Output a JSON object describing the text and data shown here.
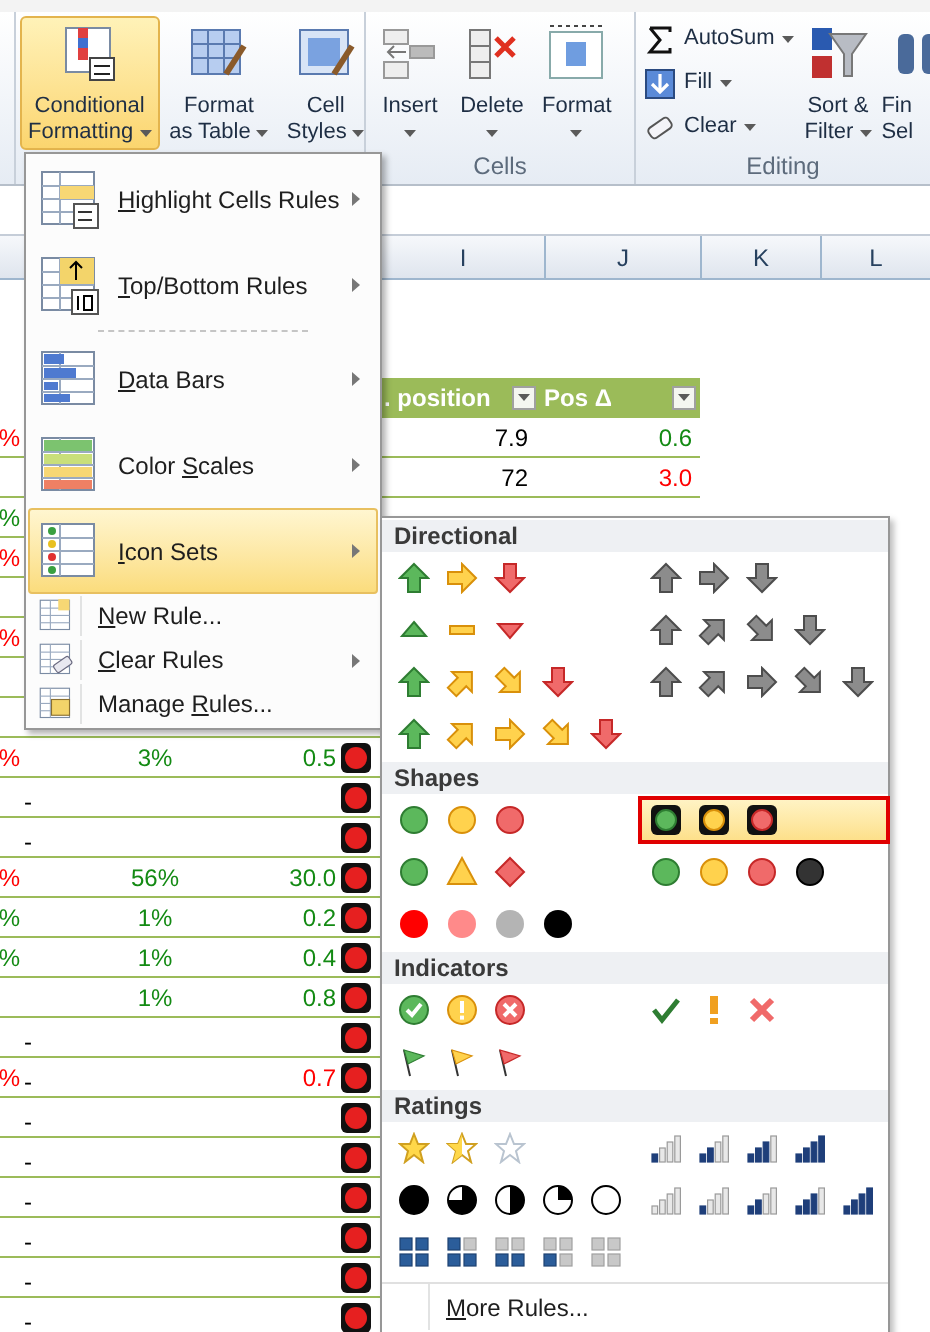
{
  "ribbon": {
    "groups": [
      {
        "buttons": [
          {
            "kind": "large",
            "lines": [
              "Conditional",
              "Formatting"
            ],
            "dropdown": true,
            "expanded": true
          },
          {
            "kind": "large",
            "lines": [
              "Format",
              "as Table"
            ],
            "dropdown": true,
            "expanded": false
          },
          {
            "kind": "large",
            "lines": [
              "Cell",
              "Styles"
            ],
            "dropdown": true,
            "expanded": false
          }
        ]
      },
      {
        "label": "Cells",
        "buttons": [
          {
            "kind": "large",
            "lines": [
              "Insert"
            ],
            "dropdown": true,
            "expanded": false
          },
          {
            "kind": "large",
            "lines": [
              "Delete"
            ],
            "dropdown": true,
            "expanded": false
          },
          {
            "kind": "large",
            "lines": [
              "Format"
            ],
            "dropdown": true,
            "expanded": false
          }
        ]
      },
      {
        "label": "Editing",
        "buttons": [
          {
            "kind": "small",
            "lines": [
              "AutoSum"
            ],
            "dropdown": true,
            "expanded": false
          },
          {
            "kind": "small",
            "lines": [
              "Fill"
            ],
            "dropdown": true,
            "expanded": false
          },
          {
            "kind": "small",
            "lines": [
              "Clear"
            ],
            "dropdown": true,
            "expanded": false
          },
          {
            "kind": "large",
            "lines": [
              "Sort &",
              "Filter"
            ],
            "dropdown": true,
            "expanded": false
          },
          {
            "kind": "large",
            "lines": [
              "Fin",
              "Sel"
            ],
            "dropdown": false,
            "expanded": false
          }
        ]
      }
    ]
  },
  "sheet": {
    "columns": [
      "I",
      "J",
      "K",
      "L"
    ],
    "table_header": [
      ". position",
      "Pos Δ"
    ],
    "rows": [
      {
        "edge": {
          "text": "%",
          "color": "#ff0000"
        },
        "i": {
          "text": "7.9",
          "color": "#000000"
        },
        "j": {
          "text": "0.6",
          "color": "#138a13"
        }
      },
      {
        "i": {
          "text": "72",
          "color": "#000000"
        },
        "j": {
          "text": "3.0",
          "color": "#ff0000"
        }
      },
      {
        "edge": {
          "text": "%",
          "color": "#138a13"
        }
      },
      {
        "edge": {
          "text": "%",
          "color": "#ff0000"
        }
      },
      {},
      {
        "edge": {
          "text": "%",
          "color": "#ff0000"
        }
      },
      {},
      {},
      {
        "edge": {
          "text": "%",
          "color": "#ff0000"
        },
        "c": {
          "text": "3%",
          "color": "#138a13"
        },
        "d": {
          "text": "0.5",
          "color": "#138a13"
        },
        "indicator": {
          "color": "#e62020"
        }
      },
      {
        "b": {
          "text": "-",
          "color": "#000000"
        },
        "indicator": {
          "color": "#e62020"
        }
      },
      {
        "b": {
          "text": "-",
          "color": "#000000"
        },
        "indicator": {
          "color": "#e62020"
        }
      },
      {
        "edge": {
          "text": "%",
          "color": "#ff0000"
        },
        "c": {
          "text": "56%",
          "color": "#138a13"
        },
        "d": {
          "text": "30.0",
          "color": "#138a13"
        },
        "indicator": {
          "color": "#e62020"
        }
      },
      {
        "edge": {
          "text": "%",
          "color": "#138a13"
        },
        "c": {
          "text": "1%",
          "color": "#138a13"
        },
        "d": {
          "text": "0.2",
          "color": "#138a13"
        },
        "indicator": {
          "color": "#e62020"
        }
      },
      {
        "edge": {
          "text": "%",
          "color": "#138a13"
        },
        "c": {
          "text": "1%",
          "color": "#138a13"
        },
        "d": {
          "text": "0.4",
          "color": "#138a13"
        },
        "indicator": {
          "color": "#e62020"
        }
      },
      {
        "c": {
          "text": "1%",
          "color": "#138a13"
        },
        "d": {
          "text": "0.8",
          "color": "#138a13"
        },
        "indicator": {
          "color": "#e62020"
        }
      },
      {
        "b": {
          "text": "-",
          "color": "#000000"
        },
        "indicator": {
          "color": "#e62020"
        }
      },
      {
        "edge": {
          "text": "%",
          "color": "#ff0000"
        },
        "b": {
          "text": "-",
          "color": "#000000"
        },
        "d": {
          "text": "0.7",
          "color": "#ff0000"
        },
        "indicator": {
          "color": "#e62020"
        }
      },
      {
        "b": {
          "text": "-",
          "color": "#000000"
        },
        "indicator": {
          "color": "#e62020"
        }
      },
      {
        "b": {
          "text": "-",
          "color": "#000000"
        },
        "indicator": {
          "color": "#e62020"
        }
      },
      {
        "b": {
          "text": "-",
          "color": "#000000"
        },
        "indicator": {
          "color": "#e62020"
        }
      },
      {
        "b": {
          "text": "-",
          "color": "#000000"
        },
        "indicator": {
          "color": "#e62020"
        }
      },
      {
        "b": {
          "text": "-",
          "color": "#000000"
        },
        "indicator": {
          "color": "#e62020"
        }
      },
      {
        "b": {
          "text": "-",
          "color": "#000000"
        },
        "indicator": {
          "color": "#e62020"
        }
      }
    ]
  },
  "menu": {
    "items": [
      {
        "kind": "large",
        "key": "H",
        "post": "ighlight Cells Rules",
        "submenu": true,
        "selected": false
      },
      {
        "kind": "large",
        "key": "T",
        "post": "op/Bottom Rules",
        "submenu": true,
        "selected": false
      },
      {
        "kind": "large",
        "key": "D",
        "post": "ata Bars",
        "submenu": true,
        "selected": false
      },
      {
        "kind": "large",
        "pre": "Color ",
        "key": "S",
        "post": "cales",
        "submenu": true,
        "selected": false
      },
      {
        "kind": "large",
        "key": "I",
        "post": "con Sets",
        "submenu": true,
        "selected": true
      },
      {
        "kind": "small",
        "key": "N",
        "post": "ew Rule...",
        "submenu": false,
        "selected": false
      },
      {
        "kind": "small",
        "key": "C",
        "post": "lear Rules",
        "submenu": true,
        "selected": false
      },
      {
        "kind": "small",
        "pre": "Manage ",
        "key": "R",
        "post": "ules...",
        "submenu": false,
        "selected": false
      }
    ]
  },
  "icon_sets": {
    "sections": [
      {
        "title": "Directional",
        "sets": [
          {
            "kind": "arrows3",
            "selected": false
          },
          {
            "kind": "grayarrows3",
            "selected": false
          },
          {
            "kind": "triangles3",
            "selected": false
          },
          {
            "kind": "grayarrows4",
            "selected": false
          },
          {
            "kind": "arrows4",
            "selected": false
          },
          {
            "kind": "grayarrows5",
            "selected": false
          },
          {
            "kind": "arrows5",
            "selected": false
          }
        ]
      },
      {
        "title": "Shapes",
        "sets": [
          {
            "kind": "lights3",
            "selected": false
          },
          {
            "kind": "rimmedlights3",
            "selected": true
          },
          {
            "kind": "signs3",
            "selected": false
          },
          {
            "kind": "lights4",
            "selected": false
          },
          {
            "kind": "redtoblack",
            "selected": false
          }
        ]
      },
      {
        "title": "Indicators",
        "sets": [
          {
            "kind": "circledsymbols3",
            "selected": false
          },
          {
            "kind": "symbols3",
            "selected": false
          },
          {
            "kind": "flags3",
            "selected": false
          }
        ]
      },
      {
        "title": "Ratings",
        "sets": [
          {
            "kind": "stars3",
            "selected": false
          },
          {
            "kind": "ratings4",
            "selected": false
          },
          {
            "kind": "quarters5",
            "selected": false
          },
          {
            "kind": "ratings5",
            "selected": false
          },
          {
            "kind": "boxes5",
            "selected": false
          }
        ]
      }
    ],
    "more": {
      "key": "M",
      "post": "ore Rules..."
    }
  }
}
